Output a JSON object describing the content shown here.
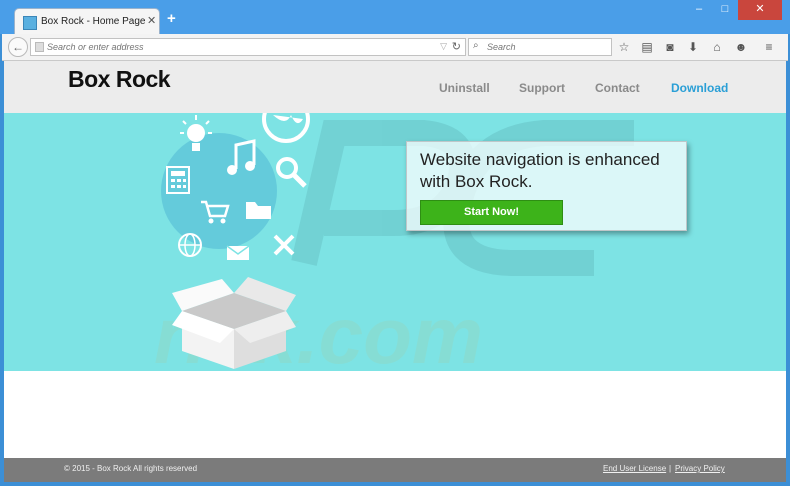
{
  "browser": {
    "tab_title": "Box Rock - Home Page",
    "new_tab_symbol": "+",
    "address_placeholder": "Search or enter address",
    "search_placeholder": "Search",
    "window_controls": [
      "–",
      "□",
      "✕"
    ]
  },
  "site": {
    "logo": "Box Rock",
    "nav": {
      "uninstall": "Uninstall",
      "support": "Support",
      "contact": "Contact",
      "download": "Download"
    },
    "hero": {
      "headline": "Website navigation is enhanced with Box Rock.",
      "cta_label": "Start Now!"
    },
    "footer": {
      "copyright": "© 2015 - Box Rock All rights reserved",
      "eula": "End User License",
      "separator": "|",
      "privacy": "Privacy Policy"
    }
  },
  "icons": [
    "lightbulb-icon",
    "globe-icon",
    "music-note-icon",
    "search-icon",
    "calculator-icon",
    "shopping-cart-icon",
    "folder-icon",
    "world-icon",
    "mail-icon",
    "tools-icon",
    "open-box-icon"
  ],
  "colors": {
    "hero_bg": "#7de3e4",
    "accent_link": "#2a9fd6",
    "cta_green": "#3db31a",
    "footer_bg": "#7b7b7b"
  }
}
